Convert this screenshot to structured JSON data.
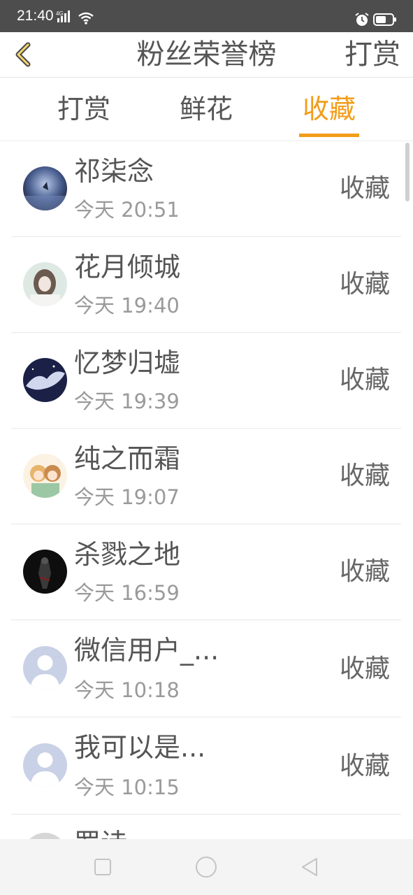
{
  "status_bar": {
    "time": "21:40",
    "network_label": "4G",
    "icons": [
      "signal-icon",
      "wifi-icon",
      "alarm-icon",
      "battery-icon"
    ]
  },
  "header": {
    "title": "粉丝荣誉榜",
    "action_label": "打赏",
    "back_icon": "chevron-left-icon"
  },
  "tabs": [
    {
      "label": "打赏",
      "active": false
    },
    {
      "label": "鲜花",
      "active": false
    },
    {
      "label": "收藏",
      "active": true
    }
  ],
  "list": {
    "items": [
      {
        "name": "祁柒念",
        "time": "今天 20:51",
        "action": "收藏"
      },
      {
        "name": "花月倾城",
        "time": "今天 19:40",
        "action": "收藏"
      },
      {
        "name": "忆梦归墟",
        "time": "今天 19:39",
        "action": "收藏"
      },
      {
        "name": "纯之而霜",
        "time": "今天 19:07",
        "action": "收藏"
      },
      {
        "name": "杀戮之地",
        "time": "今天 16:59",
        "action": "收藏"
      },
      {
        "name": "微信用户_...",
        "time": "今天 10:18",
        "action": "收藏"
      },
      {
        "name": "我可以是...",
        "time": "今天 10:15",
        "action": "收藏"
      },
      {
        "name": "罗诗…",
        "time": "",
        "action": ""
      }
    ]
  },
  "nav_bar": {
    "buttons": [
      "recent-apps-icon",
      "home-icon",
      "back-icon"
    ]
  },
  "colors": {
    "accent": "#f29d1a",
    "status_bar": "#4d4d4d",
    "text_primary": "#555555",
    "text_secondary": "#9a9a9a",
    "divider": "#e8e8e8"
  }
}
